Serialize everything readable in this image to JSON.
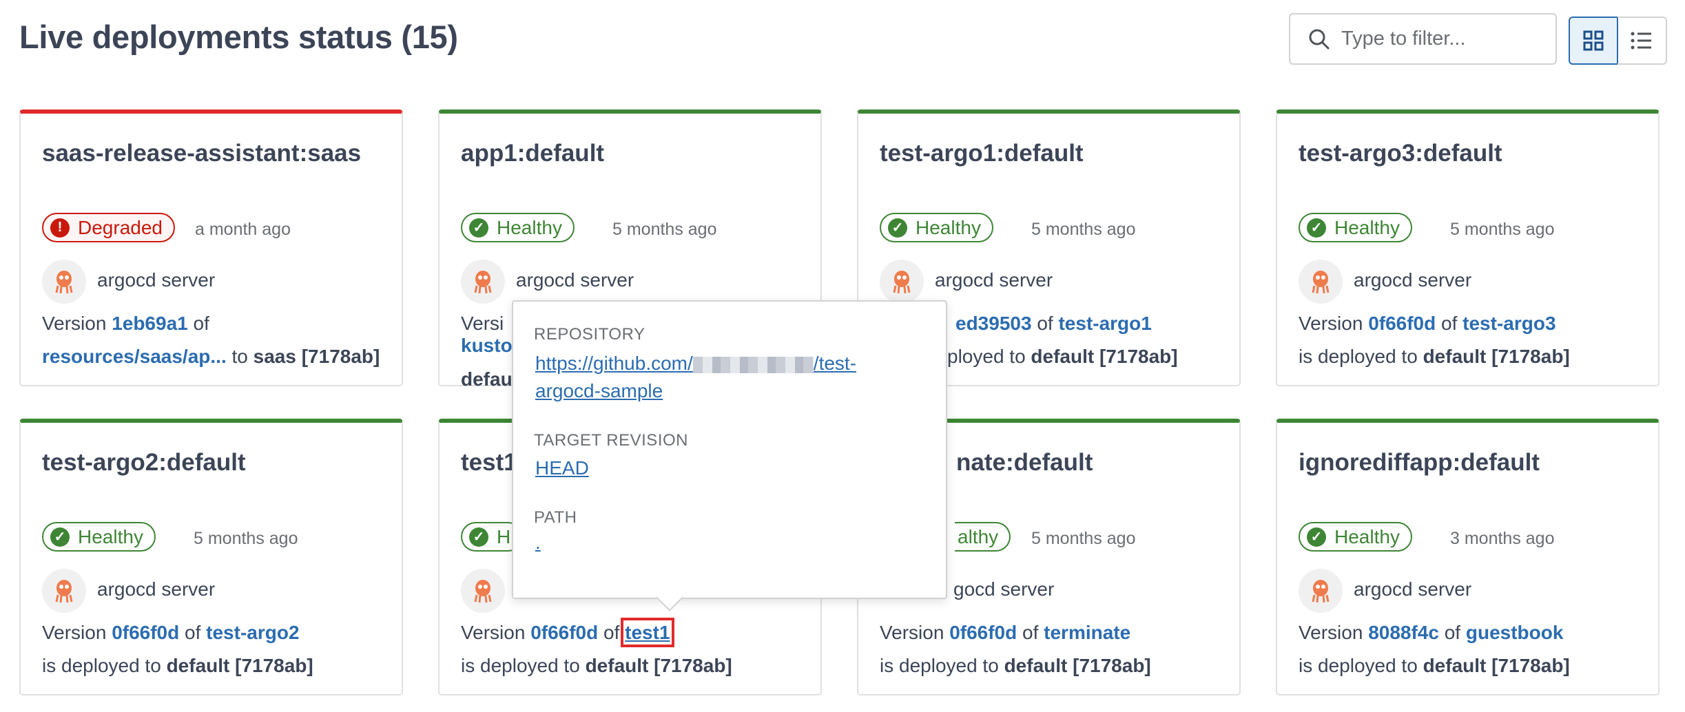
{
  "header": {
    "title": "Live deployments status (15)",
    "filter_placeholder": "Type to filter..."
  },
  "server_label": "argocd server",
  "cards": [
    {
      "title": "saas-release-assistant:saas",
      "status": "Degraded",
      "time": "a month ago",
      "version": "1eb69a1",
      "source": "resources/saas/ap...",
      "line2_prefix": "to",
      "target": "saas [7178ab]"
    },
    {
      "title": "app1:default",
      "status": "Healthy",
      "time": "5 months ago",
      "version_prefix": "Versi",
      "source": "kusto",
      "target": "defau"
    },
    {
      "title": "test-argo1:default",
      "status": "Healthy",
      "time": "5 months ago",
      "version": "ed39503",
      "source": "test-argo1",
      "line2_prefix": "ployed to",
      "target": "default [7178ab]"
    },
    {
      "title": "test-argo3:default",
      "status": "Healthy",
      "time": "5 months ago",
      "version": "0f66f0d",
      "source": "test-argo3",
      "line2_prefix": "is deployed to",
      "target": "default [7178ab]"
    },
    {
      "title": "test-argo2:default",
      "status": "Healthy",
      "time": "5 months ago",
      "version": "0f66f0d",
      "source": "test-argo2",
      "line2_prefix": "is deployed to",
      "target": "default [7178ab]"
    },
    {
      "title": "test1",
      "status": "H",
      "version": "0f66f0d",
      "source": "test1",
      "line2_prefix": "is deployed to",
      "target": "default [7178ab]"
    },
    {
      "title": "nate:default",
      "status": "althy",
      "time": "5 months ago",
      "server": "gocd server",
      "version": "0f66f0d",
      "source": "terminate",
      "line2_prefix": "is deployed to",
      "target": "default [7178ab]"
    },
    {
      "title": "ignorediffapp:default",
      "status": "Healthy",
      "time": "3 months ago",
      "version": "8088f4c",
      "source": "guestbook",
      "line2_prefix": "is deployed to",
      "target": "default [7178ab]"
    }
  ],
  "labels": {
    "version": "Version",
    "of": "of"
  },
  "popover": {
    "repository_label": "REPOSITORY",
    "repo_url_start": "https://github.com/",
    "repo_url_end": "/test-",
    "repo_url_line2": "argocd-sample",
    "revision_label": "TARGET REVISION",
    "revision": "HEAD",
    "path_label": "PATH",
    "path": "."
  },
  "colors": {
    "healthy": "#3e8635",
    "degraded": "#c9190b",
    "link": "#2b6cb0"
  }
}
